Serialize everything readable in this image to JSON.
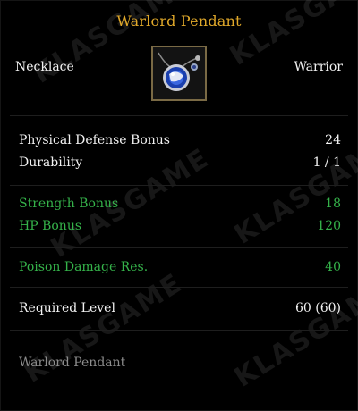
{
  "tooltip": {
    "title": "Warlord Pendant",
    "slot": "Necklace",
    "class_label": "Warrior",
    "item_icon": "pendant-item-icon",
    "base_stats": [
      {
        "label": "Physical Defense Bonus",
        "value": "24"
      },
      {
        "label": "Durability",
        "value": "1 / 1"
      }
    ],
    "bonus_stats": [
      {
        "label": "Strength Bonus",
        "value": "18"
      },
      {
        "label": "HP Bonus",
        "value": "120"
      }
    ],
    "resist_stats": [
      {
        "label": "Poison Damage Res.",
        "value": "40"
      }
    ],
    "requirement": {
      "label": "Required Level",
      "value": "60 (60)"
    },
    "description": "Warlord Pendant"
  },
  "watermark": "KLASGAME",
  "colors": {
    "title": "#e0a82a",
    "text": "#f2f2f2",
    "bonus": "#35b24a",
    "description": "#8d8d8d",
    "background": "#000000"
  }
}
